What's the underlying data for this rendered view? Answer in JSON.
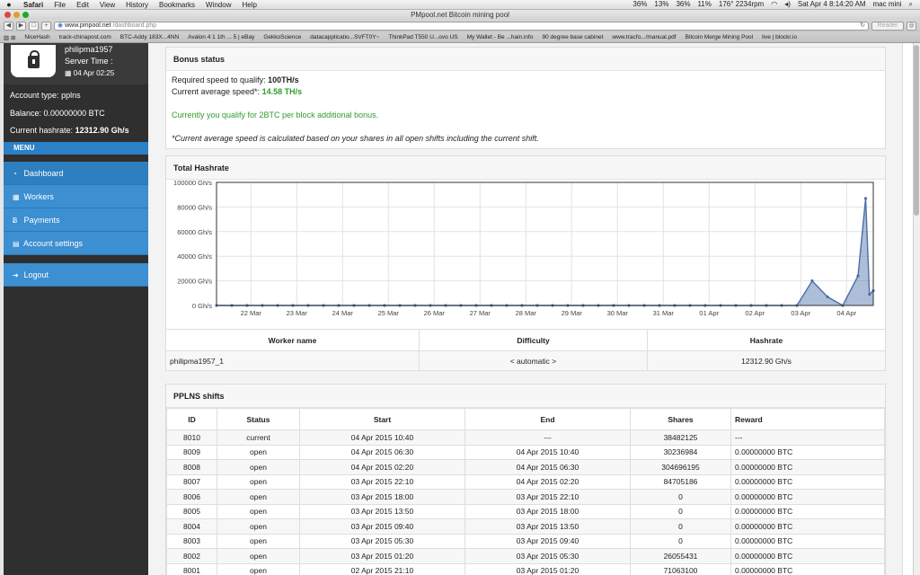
{
  "menubar": {
    "app": "Safari",
    "items": [
      "File",
      "Edit",
      "View",
      "History",
      "Bookmarks",
      "Window",
      "Help"
    ],
    "status": [
      "36%",
      "13%",
      "36%",
      "11%",
      "176° 2234rpm",
      "Sat Apr 4  8:14:20 AM",
      "mac mini"
    ]
  },
  "window": {
    "title": "PMpool.net Bitcoin mining pool"
  },
  "browser": {
    "url_host": "www.pmpool.net",
    "url_path": "/dashboard.php",
    "reader": "Reader",
    "bookmarks": [
      "NiceHash",
      "track-chinapost.com",
      "BTC-Addy 183X...4NN",
      "Avalon 4 1 1th ... 5 | eBay",
      "GekkoScience",
      "datacapplicatio...SVFT0Y~",
      "ThinkPad T550 U...ovo US",
      "My Wallet - Be ...hain.info",
      "90 degree base cabinet",
      "www.tracfo.../manual.pdf",
      "Bitcoin Merge Mining Pool",
      "live | blockr.io"
    ]
  },
  "sidebar": {
    "username": "philipma1957",
    "server_time_label": "Server Time :",
    "server_time": "04 Apr 02:25",
    "account_type_label": "Account type:",
    "account_type": "pplns",
    "balance_label": "Balance:",
    "balance": "0.00000000 BTC",
    "hashrate_label": "Current hashrate:",
    "hashrate": "12312.90 Gh/s",
    "menu_label": "MENU",
    "items": [
      {
        "label": "Dashboard",
        "icon": "dashboard-icon"
      },
      {
        "label": "Workers",
        "icon": "table-icon"
      },
      {
        "label": "Payments",
        "icon": "bitcoin-icon"
      },
      {
        "label": "Account settings",
        "icon": "file-icon"
      },
      {
        "label": "Logout",
        "icon": "signout-icon"
      }
    ]
  },
  "bonus": {
    "title": "Bonus status",
    "required_label": "Required speed to qualify:",
    "required_value": "100TH/s",
    "current_label": "Current average speed*:",
    "current_value": "14.58 TH/s",
    "qualify_text": "Currently you qualify for 2BTC per block additional bonus.",
    "note": "*Current average speed is calculated based on your shares in all open shifts including the current shift."
  },
  "hashrate_panel": {
    "title": "Total Hashrate"
  },
  "chart_data": {
    "type": "area",
    "title": "Total Hashrate",
    "y_unit": "Gh/s",
    "ylim": [
      0,
      100000
    ],
    "y_ticks": [
      "100000 Gh/s",
      "80000 Gh/s",
      "60000 Gh/s",
      "40000 Gh/s",
      "20000 Gh/s",
      "0 Gh/s"
    ],
    "x_ticks": [
      "22 Mar",
      "23 Mar",
      "24 Mar",
      "25 Mar",
      "26 Mar",
      "27 Mar",
      "28 Mar",
      "29 Mar",
      "30 Mar",
      "31 Mar",
      "01 Apr",
      "02 Apr",
      "03 Apr",
      "04 Apr"
    ],
    "x_start": "2015-03-21 06:00",
    "x_end": "2015-04-04 14:00",
    "grid": true,
    "series": [
      {
        "color": "#4a6fa8",
        "points": [
          [
            "2015-03-21 06:00",
            0
          ],
          [
            "2015-03-21 14:00",
            0
          ],
          [
            "2015-03-21 22:00",
            0
          ],
          [
            "2015-03-22 06:00",
            0
          ],
          [
            "2015-03-22 14:00",
            0
          ],
          [
            "2015-03-22 22:00",
            0
          ],
          [
            "2015-03-23 06:00",
            0
          ],
          [
            "2015-03-23 14:00",
            0
          ],
          [
            "2015-03-23 22:00",
            0
          ],
          [
            "2015-03-24 06:00",
            0
          ],
          [
            "2015-03-24 14:00",
            0
          ],
          [
            "2015-03-24 22:00",
            0
          ],
          [
            "2015-03-25 06:00",
            0
          ],
          [
            "2015-03-25 14:00",
            0
          ],
          [
            "2015-03-25 22:00",
            0
          ],
          [
            "2015-03-26 06:00",
            0
          ],
          [
            "2015-03-26 14:00",
            0
          ],
          [
            "2015-03-26 22:00",
            0
          ],
          [
            "2015-03-27 06:00",
            0
          ],
          [
            "2015-03-27 14:00",
            0
          ],
          [
            "2015-03-27 22:00",
            0
          ],
          [
            "2015-03-28 06:00",
            0
          ],
          [
            "2015-03-28 14:00",
            0
          ],
          [
            "2015-03-28 22:00",
            0
          ],
          [
            "2015-03-29 06:00",
            0
          ],
          [
            "2015-03-29 14:00",
            0
          ],
          [
            "2015-03-29 22:00",
            0
          ],
          [
            "2015-03-30 06:00",
            0
          ],
          [
            "2015-03-30 14:00",
            0
          ],
          [
            "2015-03-30 22:00",
            0
          ],
          [
            "2015-03-31 06:00",
            0
          ],
          [
            "2015-03-31 14:00",
            0
          ],
          [
            "2015-03-31 22:00",
            0
          ],
          [
            "2015-04-01 06:00",
            0
          ],
          [
            "2015-04-01 14:00",
            0
          ],
          [
            "2015-04-01 22:00",
            0
          ],
          [
            "2015-04-02 06:00",
            0
          ],
          [
            "2015-04-02 14:00",
            0
          ],
          [
            "2015-04-02 22:00",
            0
          ],
          [
            "2015-04-03 06:00",
            20000
          ],
          [
            "2015-04-03 14:00",
            7000
          ],
          [
            "2015-04-03 22:00",
            0
          ],
          [
            "2015-04-04 06:00",
            24000
          ],
          [
            "2015-04-04 10:00",
            87000
          ],
          [
            "2015-04-04 12:00",
            9000
          ],
          [
            "2015-04-04 14:00",
            12000
          ]
        ]
      }
    ]
  },
  "workers": {
    "headers": [
      "Worker name",
      "Difficulty",
      "Hashrate"
    ],
    "rows": [
      [
        "philipma1957_1",
        "< automatic >",
        "12312.90 Gh/s"
      ]
    ]
  },
  "shifts": {
    "title": "PPLNS shifts",
    "headers": [
      "ID",
      "Status",
      "Start",
      "End",
      "Shares",
      "Reward"
    ],
    "rows": [
      [
        "8010",
        "current",
        "04 Apr 2015 10:40",
        "---",
        "38482125",
        "---"
      ],
      [
        "8009",
        "open",
        "04 Apr 2015 06:30",
        "04 Apr 2015 10:40",
        "30236984",
        "0.00000000 BTC"
      ],
      [
        "8008",
        "open",
        "04 Apr 2015 02:20",
        "04 Apr 2015 06:30",
        "304696195",
        "0.00000000 BTC"
      ],
      [
        "8007",
        "open",
        "03 Apr 2015 22:10",
        "04 Apr 2015 02:20",
        "84705186",
        "0.00000000 BTC"
      ],
      [
        "8006",
        "open",
        "03 Apr 2015 18:00",
        "03 Apr 2015 22:10",
        "0",
        "0.00000000 BTC"
      ],
      [
        "8005",
        "open",
        "03 Apr 2015 13:50",
        "03 Apr 2015 18:00",
        "0",
        "0.00000000 BTC"
      ],
      [
        "8004",
        "open",
        "03 Apr 2015 09:40",
        "03 Apr 2015 13:50",
        "0",
        "0.00000000 BTC"
      ],
      [
        "8003",
        "open",
        "03 Apr 2015 05:30",
        "03 Apr 2015 09:40",
        "0",
        "0.00000000 BTC"
      ],
      [
        "8002",
        "open",
        "03 Apr 2015 01:20",
        "03 Apr 2015 05:30",
        "26055431",
        "0.00000000 BTC"
      ],
      [
        "8001",
        "open",
        "02 Apr 2015 21:10",
        "03 Apr 2015 01:20",
        "71063100",
        "0.00000000 BTC"
      ]
    ]
  }
}
